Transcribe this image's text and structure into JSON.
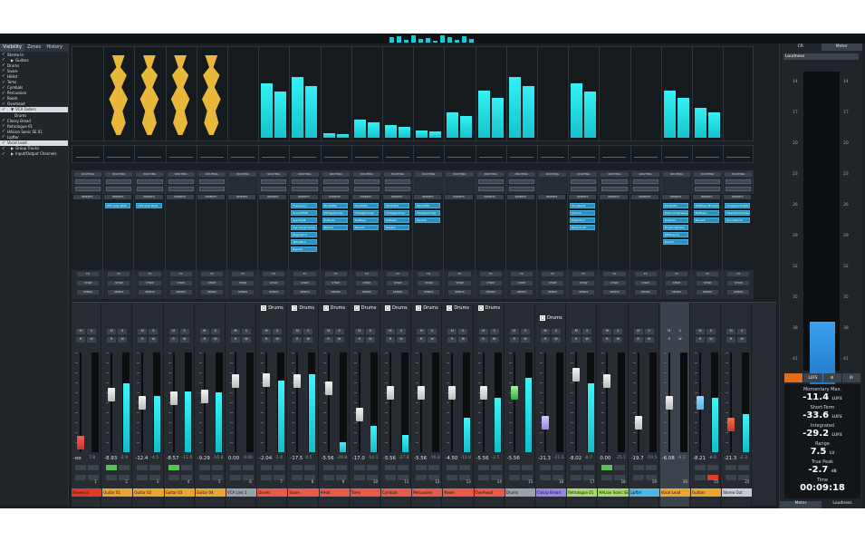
{
  "visibility_panel": {
    "tabs": [
      "Visibility",
      "Zones",
      "History"
    ],
    "items": [
      {
        "label": "Stereo In",
        "checked": true,
        "expand": false,
        "selected": false,
        "indent": 0
      },
      {
        "label": "Guitars",
        "checked": true,
        "expand": true,
        "selected": false,
        "indent": 1
      },
      {
        "label": "Drums",
        "checked": true,
        "expand": false,
        "selected": false,
        "indent": 0
      },
      {
        "label": "Snare",
        "checked": true,
        "expand": false,
        "selected": false,
        "indent": 0
      },
      {
        "label": "HiHat",
        "checked": true,
        "expand": false,
        "selected": false,
        "indent": 0
      },
      {
        "label": "Toms",
        "checked": true,
        "expand": false,
        "selected": false,
        "indent": 0
      },
      {
        "label": "Cymbals",
        "checked": true,
        "expand": false,
        "selected": false,
        "indent": 0
      },
      {
        "label": "Percussion",
        "checked": true,
        "expand": false,
        "selected": false,
        "indent": 0
      },
      {
        "label": "Room",
        "checked": true,
        "expand": false,
        "selected": false,
        "indent": 0
      },
      {
        "label": "Overhead",
        "checked": true,
        "expand": false,
        "selected": false,
        "indent": 0
      },
      {
        "label": "VCA Faders",
        "checked": true,
        "expand": true,
        "selected": true,
        "indent": 1
      },
      {
        "label": "Drums",
        "checked": false,
        "expand": false,
        "selected": false,
        "indent": 2
      },
      {
        "label": "Classy Bread",
        "checked": true,
        "expand": false,
        "selected": false,
        "indent": 0
      },
      {
        "label": "Retrologue 01",
        "checked": true,
        "expand": false,
        "selected": false,
        "indent": 0
      },
      {
        "label": "HALion Sonic SE 01",
        "checked": true,
        "expand": false,
        "selected": false,
        "indent": 0
      },
      {
        "label": "Lipfter",
        "checked": true,
        "expand": false,
        "selected": false,
        "indent": 0
      },
      {
        "label": "Vocal Lead",
        "checked": true,
        "expand": false,
        "selected": true,
        "indent": 0
      },
      {
        "label": "Group Tracks",
        "checked": true,
        "expand": true,
        "selected": false,
        "indent": 1
      },
      {
        "label": "Input/Output Channels",
        "checked": true,
        "expand": true,
        "selected": false,
        "indent": 1
      }
    ]
  },
  "routing_label": "ROUTING",
  "inserts_label": "INSERTS",
  "sends": {
    "fx": "FX",
    "strip": "STRIP",
    "sends": "SENDS"
  },
  "insert_plugins": {
    "col1": [
      "VST Amp Rack"
    ],
    "col2": [
      "VST Amp Rack"
    ],
    "col7": [
      "Frequency",
      "SoundShift",
      "SendSplit",
      "Dyn Vocal Comp",
      "Magneto II",
      "WhiteBox",
      "Reverb"
    ],
    "col8": [
      "StudioEQ",
      "VintageCompr",
      "DeEsser",
      "Reverb"
    ],
    "col9": [
      "StudioEQ",
      "VintageCompr",
      "DeEsser",
      "Reverb"
    ],
    "col10": [
      "StudioEQ",
      "VintageCompr",
      "DeEsser",
      "Reverb"
    ],
    "col11": [
      "StudioEQ",
      "VintageCompr",
      "Reverb"
    ],
    "col16": [
      "SongSend",
      "Chorus",
      "Distortion",
      "Reverb 2D"
    ],
    "col19": [
      "StudioEQ",
      "Tube Compressor",
      "DeEsser",
      "PingPongDelay",
      "REVerence",
      "Reverb"
    ],
    "col20": [
      "MultibandEnvelope",
      "DeEsser",
      "Reverb"
    ],
    "col21": [
      "ImageController",
      "DeessCompressor",
      "RoomWorks"
    ]
  },
  "drum_group_label": "Drums",
  "channels": [
    {
      "number": "1",
      "name": "Stereo In",
      "color": "#e23a2a",
      "volume": "-oo",
      "pan": "7.8",
      "meter": 0.0,
      "fader": 0.1
    },
    {
      "number": "2",
      "name": "Guitar 01",
      "color": "#e8a630",
      "volume": "-8.93",
      "pan": "-2.9",
      "meter": 0.69,
      "fader": 0.58
    },
    {
      "number": "3",
      "name": "Guitar 02",
      "color": "#e8a630",
      "volume": "-12.4",
      "pan": "-4.5",
      "meter": 0.56,
      "fader": 0.5
    },
    {
      "number": "4",
      "name": "Guitar 03",
      "color": "#e8a630",
      "volume": "-8.57",
      "pan": "-11.6",
      "meter": 0.61,
      "fader": 0.55
    },
    {
      "number": "5",
      "name": "Guitar 04",
      "color": "#e8a630",
      "volume": "-9.29",
      "pan": "-10.8",
      "meter": 0.6,
      "fader": 0.56
    },
    {
      "number": "6",
      "name": "VCA Link 1",
      "color": "#9aa2a8",
      "volume": "0.00",
      "pan": "0.00",
      "meter": 0.0,
      "fader": 0.72
    },
    {
      "number": "7",
      "name": "Drums",
      "color": "#e85a4a",
      "volume": "-2.04",
      "pan": "-1.4",
      "meter": 0.72,
      "fader": 0.73
    },
    {
      "number": "8",
      "name": "Snare",
      "color": "#e85a4a",
      "volume": "-17.5",
      "pan": "0.5",
      "meter": 0.78,
      "fader": 0.72
    },
    {
      "number": "9",
      "name": "HiHat",
      "color": "#e85a4a",
      "volume": "-5.56",
      "pan": "-20.8",
      "meter": 0.1,
      "fader": 0.65
    },
    {
      "number": "10",
      "name": "Toms",
      "color": "#e85a4a",
      "volume": "-17.0",
      "pan": "-14.1",
      "meter": 0.26,
      "fader": 0.38
    },
    {
      "number": "11",
      "name": "Cymbals",
      "color": "#e85a4a",
      "volume": "-5.56",
      "pan": "-27.8",
      "meter": 0.17,
      "fader": 0.6
    },
    {
      "number": "12",
      "name": "Percussion",
      "color": "#e85a4a",
      "volume": "-5.56",
      "pan": "-16.8",
      "meter": 0.0,
      "fader": 0.6
    },
    {
      "number": "13",
      "name": "Room",
      "color": "#e85a4a",
      "volume": "-4.50",
      "pan": "-12.0",
      "meter": 0.35,
      "fader": 0.6
    },
    {
      "number": "14",
      "name": "Overhead",
      "color": "#e85a4a",
      "volume": "-5.56",
      "pan": "-2.5",
      "meter": 0.55,
      "fader": 0.6
    },
    {
      "number": "15",
      "name": "Drums",
      "color": "#9aa2a8",
      "volume": "-5.56",
      "pan": "",
      "meter": 0.75,
      "fader": 0.6
    },
    {
      "number": "16",
      "name": "Classy Bread",
      "color": "#9a83e8",
      "volume": "-21.3",
      "pan": "-21.6",
      "meter": 0.0,
      "fader": 0.3
    },
    {
      "number": "17",
      "name": "Retrologue 01",
      "color": "#a6d86a",
      "volume": "-8.02",
      "pan": "-8.7",
      "meter": 0.69,
      "fader": 0.78
    },
    {
      "number": "18",
      "name": "HALion Sonic SE 01",
      "color": "#a6d86a",
      "volume": "0.00",
      "pan": "-25.1",
      "meter": 0.0,
      "fader": 0.72
    },
    {
      "number": "19",
      "name": "Lipfter",
      "color": "#52b6e2",
      "volume": "-19.7",
      "pan": "-19.5",
      "meter": 0.0,
      "fader": 0.3
    },
    {
      "number": "20",
      "name": "Vocal Lead",
      "color": "#e8a630",
      "volume": "-6.08",
      "pan": "-8.3",
      "meter": 0.0,
      "fader": 0.5
    },
    {
      "number": "21",
      "name": "Guitars",
      "color": "#e8a630",
      "volume": "-8.21",
      "pan": "-8.0",
      "meter": 0.55,
      "fader": 0.5
    },
    {
      "number": "22",
      "name": "Stereo Out",
      "color": "#c7cdd2",
      "volume": "-21.3",
      "pan": "-2.3",
      "meter": 0.38,
      "fader": 0.28
    }
  ],
  "right_panel": {
    "tabs": [
      "CR",
      "Meter"
    ],
    "header": "Loudness",
    "scale": [
      "14",
      "17",
      "20",
      "23",
      "26",
      "29",
      "32",
      "35",
      "38",
      "41"
    ],
    "meter_level": 0.26,
    "buttons": [
      "",
      "LUFS",
      "",
      "III"
    ],
    "momentary_max_label": "Momentary Max.",
    "momentary_max": "-11.4",
    "short_term_label": "Short-Term",
    "short_term": "-33.6",
    "integrated_label": "Integrated",
    "integrated": "-29.2",
    "range_label": "Range",
    "range": "7.5",
    "true_peak_label": "True Peak",
    "true_peak": "-2.7",
    "time_label": "Time",
    "time": "00:09:18",
    "unit": "LUFS",
    "range_unit": "LU",
    "peak_unit": "dB",
    "bottom_tabs": [
      "Meter",
      "Loudness"
    ]
  },
  "colors": {
    "accent": "#1fc7d0",
    "wave": "#e9b73a",
    "insert": "#2891c0",
    "bg": "#1b1f23"
  }
}
